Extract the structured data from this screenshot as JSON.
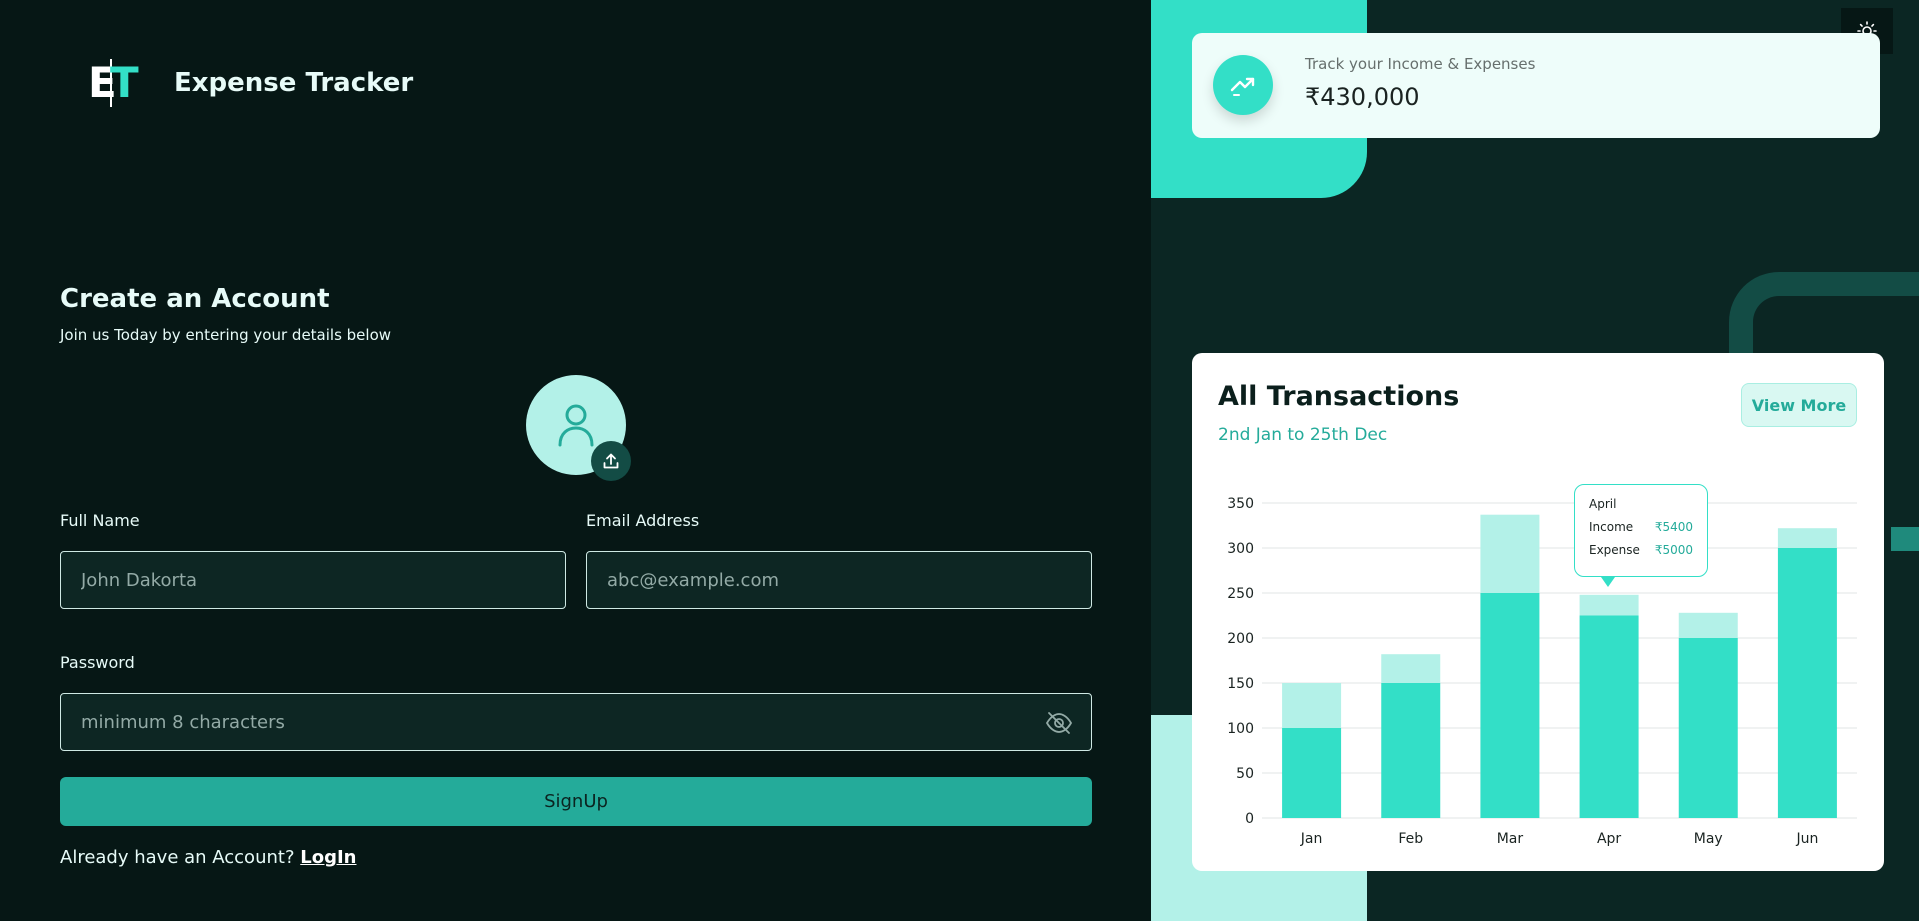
{
  "brand": {
    "logo_letter_1": "E",
    "logo_letter_2": "T",
    "name": "Expense Tracker"
  },
  "form": {
    "title": "Create an Account",
    "subtitle": "Join us Today by entering your details below",
    "full_name": {
      "label": "Full Name",
      "placeholder": "John Dakorta",
      "value": ""
    },
    "email": {
      "label": "Email Address",
      "placeholder": "abc@example.com",
      "value": ""
    },
    "password": {
      "label": "Password",
      "placeholder": "minimum 8 characters",
      "value": ""
    },
    "submit_label": "SignUp",
    "login_prompt": "Already have an Account?",
    "login_link": "LogIn"
  },
  "summary": {
    "label": "Track your Income & Expenses",
    "value": "₹430,000"
  },
  "transactions": {
    "title": "All Transactions",
    "subtitle": "2nd Jan to 25th Dec",
    "view_more": "View More",
    "tooltip": {
      "month": "April",
      "income_label": "Income",
      "income_value": "₹5400",
      "expense_label": "Expense",
      "expense_value": "₹5000"
    }
  },
  "colors": {
    "accent": "#33dfc7",
    "accent_light": "#b3f1e8",
    "accent_dark": "#24ab9a",
    "bg_dark": "#061715"
  },
  "chart_data": {
    "type": "bar",
    "categories": [
      "Jan",
      "Feb",
      "Mar",
      "Apr",
      "May",
      "Jun"
    ],
    "series": [
      {
        "values": [
          100,
          150,
          250,
          225,
          200,
          300
        ],
        "color": "#33dfc7"
      },
      {
        "values": [
          50,
          32,
          87,
          23,
          28,
          22
        ],
        "color": "#b3f1e8"
      }
    ],
    "stacked": true,
    "ylim": [
      0,
      350
    ],
    "yticks": [
      0,
      50,
      100,
      150,
      200,
      250,
      300,
      350
    ],
    "grid": true
  }
}
